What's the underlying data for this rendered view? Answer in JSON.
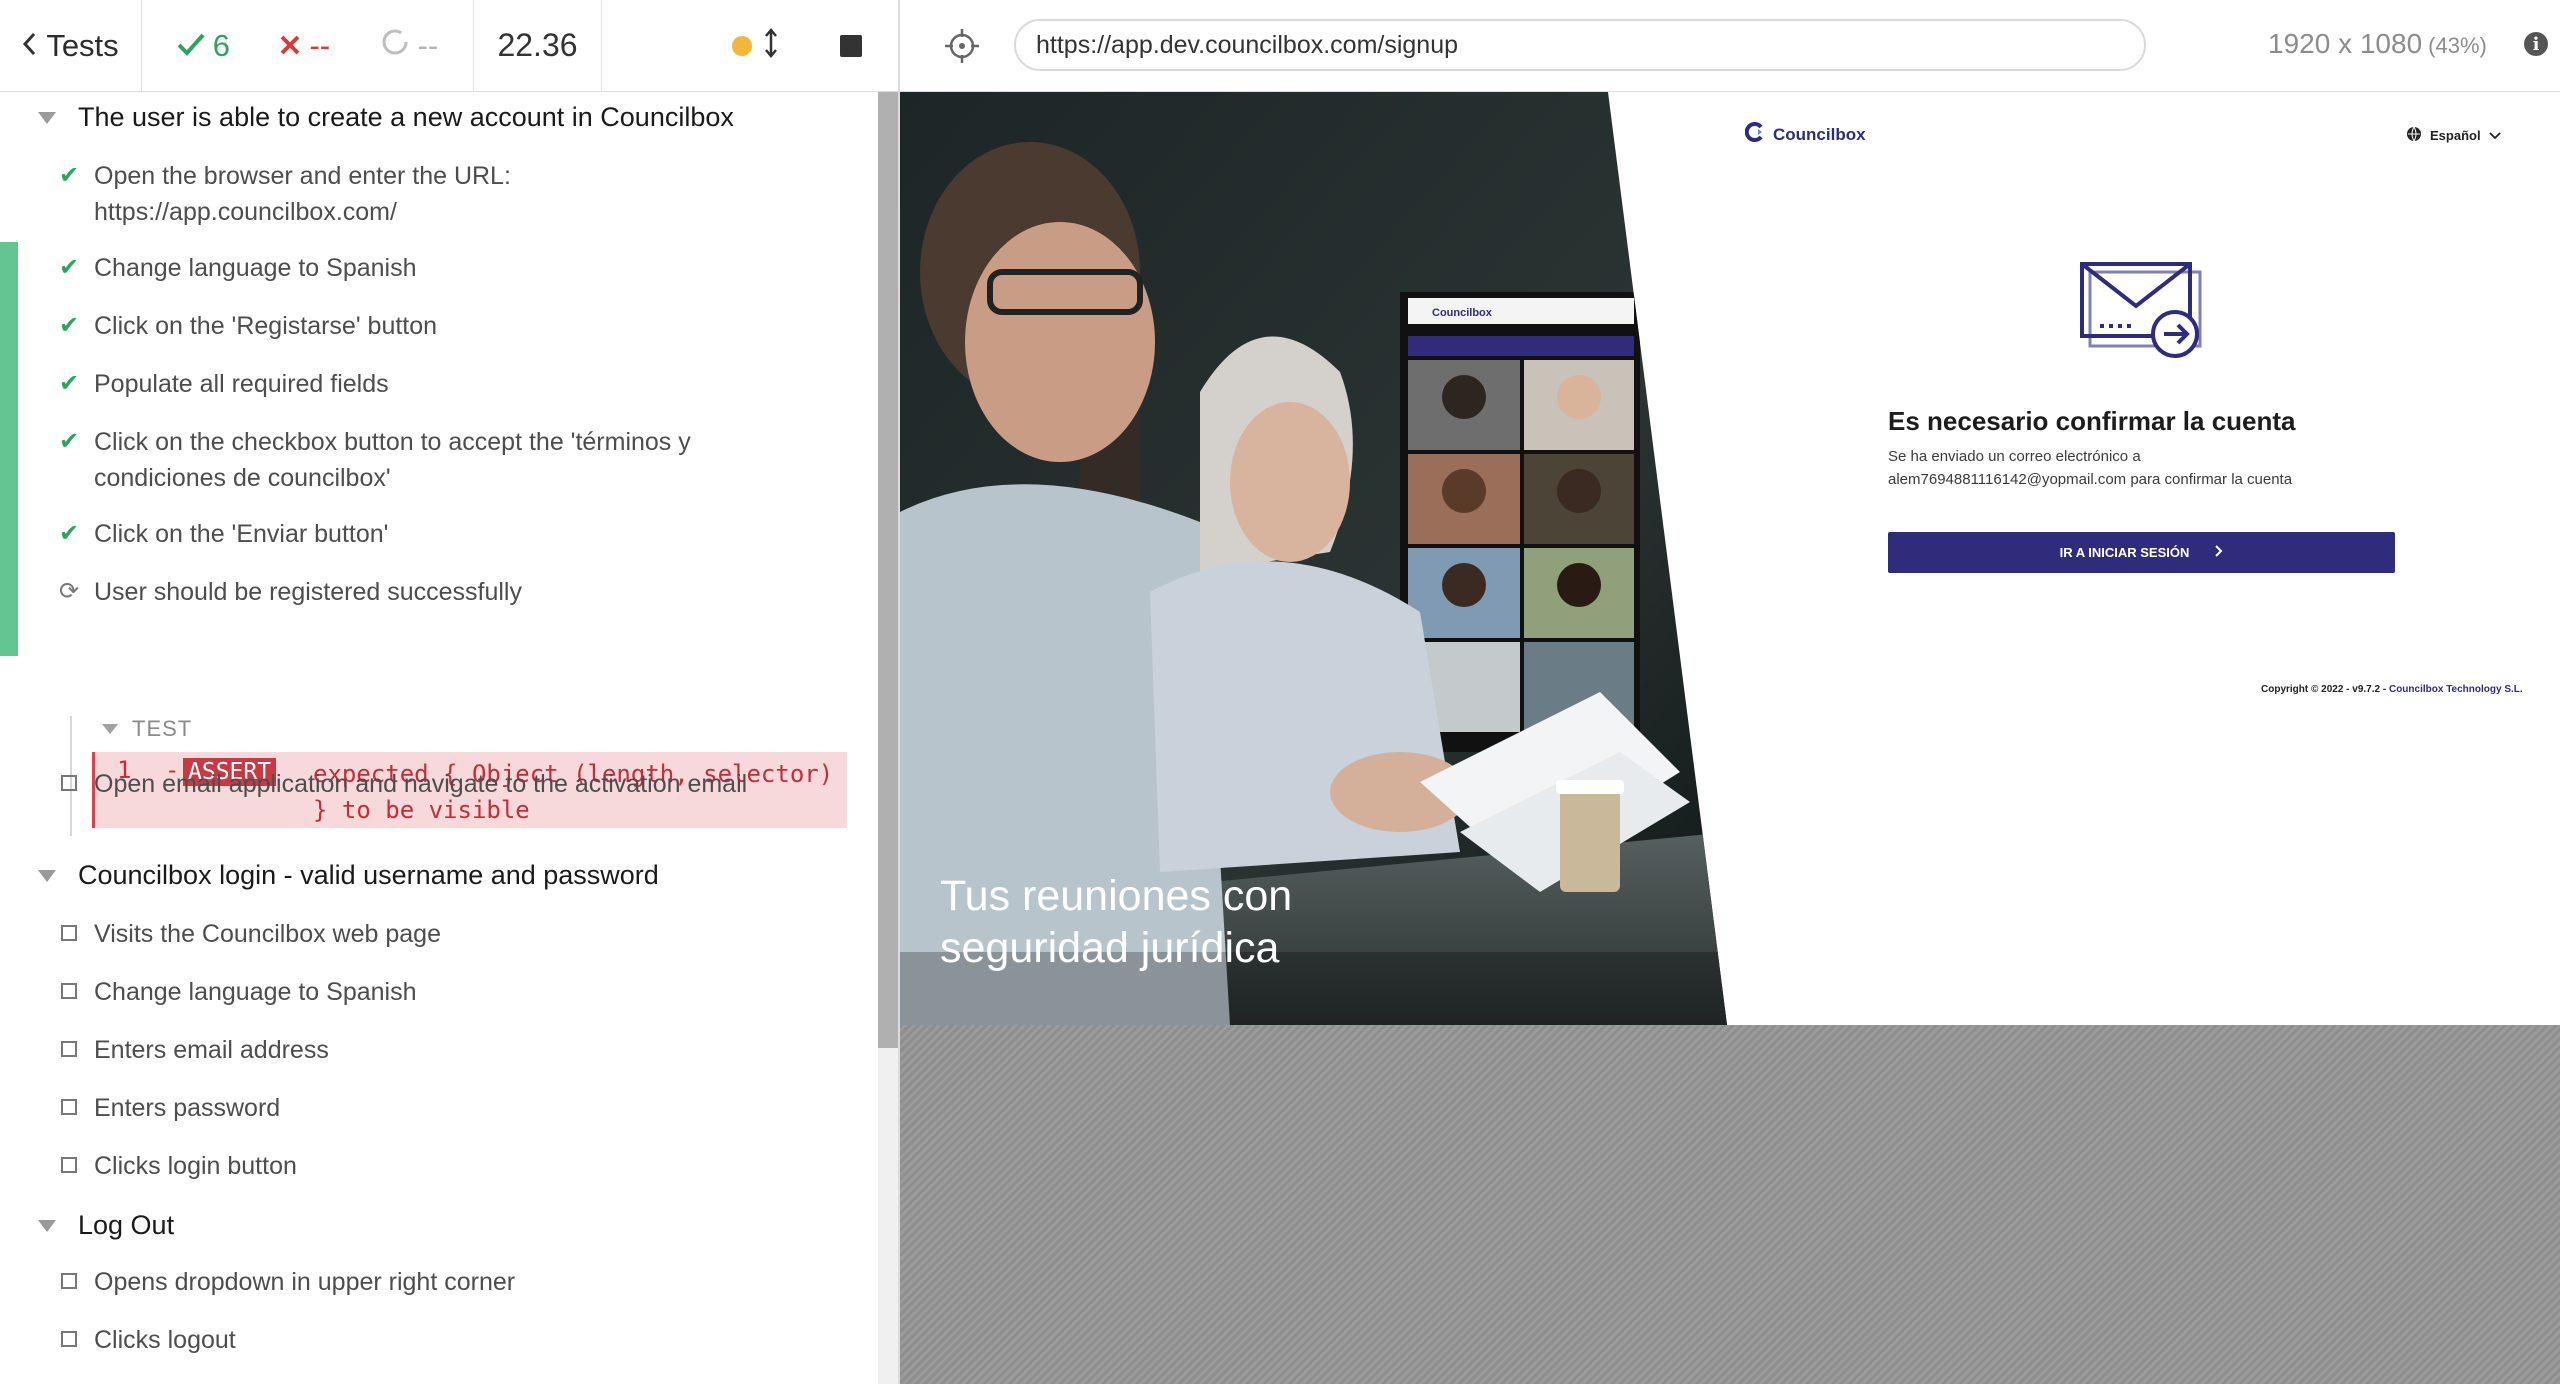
{
  "runner": {
    "tests_label": "Tests",
    "passed": "6",
    "failed": "--",
    "pending": "--",
    "duration": "22.36"
  },
  "aut": {
    "url": "https://app.dev.councilbox.com/signup",
    "viewport": "1920 x 1080",
    "zoom": "(43%)",
    "info": "i"
  },
  "suites": [
    {
      "title": "The user is able to create a new account in Councilbox",
      "steps": [
        {
          "text": "Open the browser and enter the URL: https://app.councilbox.com/",
          "state": "passed"
        },
        {
          "text": "Change language to Spanish",
          "state": "passed"
        },
        {
          "text": "Click on the 'Registarse' button",
          "state": "passed"
        },
        {
          "text": "Populate all required fields",
          "state": "passed"
        },
        {
          "text": "Click on the checkbox button to accept the 'términos y condiciones de councilbox'",
          "state": "passed"
        },
        {
          "text": "Click on the 'Enviar button'",
          "state": "passed"
        },
        {
          "text": "User should be registered successfully",
          "state": "running"
        },
        {
          "text": "Open email application and navigate to the activation email",
          "state": "pending"
        }
      ]
    },
    {
      "title": "Councilbox login - valid username and password",
      "steps": [
        {
          "text": "Visits the Councilbox web page",
          "state": "pending"
        },
        {
          "text": "Change language to Spanish",
          "state": "pending"
        },
        {
          "text": "Enters email address",
          "state": "pending"
        },
        {
          "text": "Enters password",
          "state": "pending"
        },
        {
          "text": "Clicks login button",
          "state": "pending"
        }
      ]
    },
    {
      "title": "Log Out",
      "steps": [
        {
          "text": "Opens dropdown in upper right corner",
          "state": "pending"
        },
        {
          "text": "Clicks logout",
          "state": "pending"
        }
      ]
    }
  ],
  "command_log": {
    "test_label": "TEST",
    "number": "1",
    "dash": "-",
    "badge": "ASSERT",
    "message": "expected { Object (length, selector) } to be visible"
  },
  "app": {
    "hero_text": "Tus reuniones con seguridad jurídica",
    "laptop_brand": "Councilbox",
    "logo_text": "Councilbox",
    "language": "Español",
    "confirm_title": "Es necesario confirmar la cuenta",
    "confirm_line1": "Se ha enviado un correo electrónico a",
    "confirm_line2": "alem7694881116142@yopmail.com para confirmar la cuenta",
    "login_button": "IR A INICIAR SESIÓN",
    "copyright_main": "Copyright © 2022 - v9.7.2 - ",
    "copyright_company": "Councilbox Technology S.L."
  },
  "colors": {
    "pass": "#2ea35f",
    "fail": "#d83a3a",
    "brand": "#2f2c7c",
    "assert_bg": "#f7d9dc",
    "running_dot": "#f2b63a"
  }
}
